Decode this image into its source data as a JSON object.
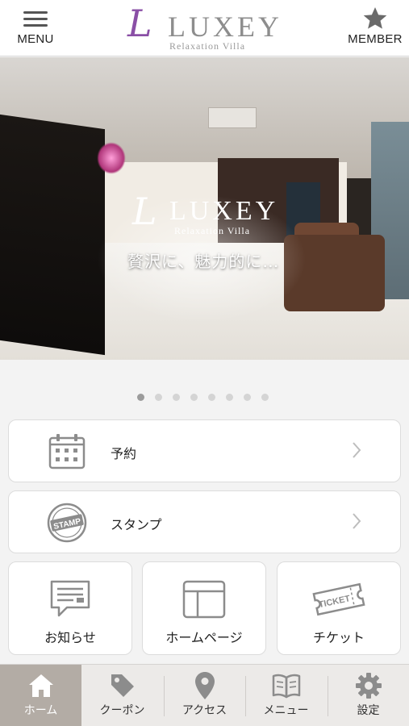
{
  "header": {
    "menu_label": "MENU",
    "member_label": "MEMBER",
    "logo_letter": "L",
    "logo_name": "LUXEY",
    "logo_sub": "Relaxation Villa"
  },
  "hero": {
    "logo_letter": "L",
    "logo_name": "LUXEY",
    "logo_sub": "Relaxation Villa",
    "catch": "贅沢に、魅力的に…"
  },
  "carousel": {
    "total": 8,
    "active": 0
  },
  "menu_cards": [
    {
      "label": "予約",
      "icon": "calendar-icon"
    },
    {
      "label": "スタンプ",
      "icon": "stamp-icon"
    }
  ],
  "tiles": [
    {
      "label": "お知らせ",
      "icon": "news-icon"
    },
    {
      "label": "ホームページ",
      "icon": "homepage-icon"
    },
    {
      "label": "チケット",
      "icon": "ticket-icon"
    }
  ],
  "tabs": [
    {
      "label": "ホーム",
      "icon": "home-icon",
      "active": true
    },
    {
      "label": "クーポン",
      "icon": "coupon-tag-icon",
      "active": false
    },
    {
      "label": "アクセス",
      "icon": "map-pin-icon",
      "active": false
    },
    {
      "label": "メニュー",
      "icon": "book-icon",
      "active": false
    },
    {
      "label": "設定",
      "icon": "gear-icon",
      "active": false
    }
  ],
  "colors": {
    "brand_purple": "#8a4fa6",
    "icon_gray": "#8c8c8c",
    "tab_active": "#b3aca5"
  }
}
